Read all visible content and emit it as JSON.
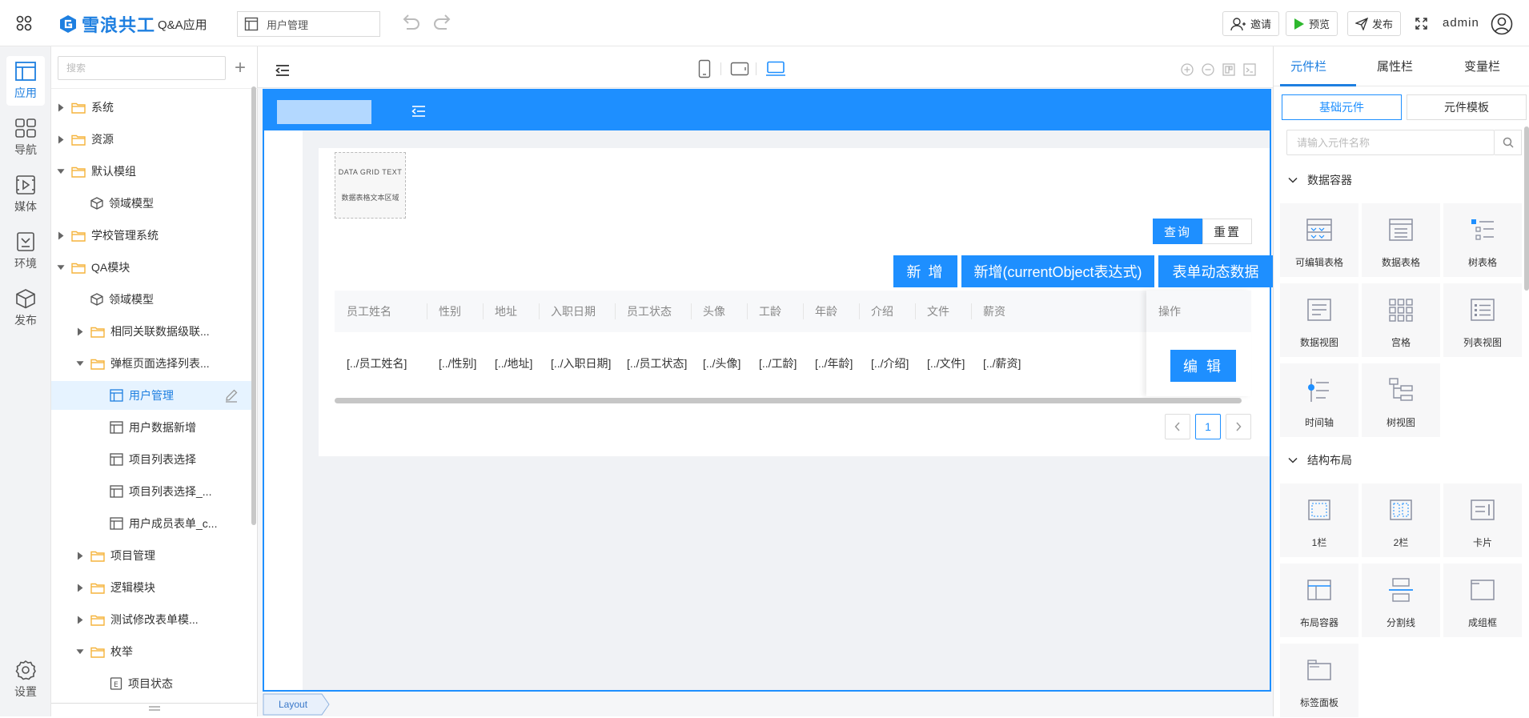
{
  "topbar": {
    "brand": "雪浪共工",
    "app_name": "Q&A应用",
    "current_page": "用户管理",
    "invite_label": "邀请",
    "preview_label": "预览",
    "publish_label": "发布",
    "user_name": "admin"
  },
  "rail": {
    "items": [
      {
        "label": "应用",
        "icon": "app-layout-icon"
      },
      {
        "label": "导航",
        "icon": "nav-grid-icon"
      },
      {
        "label": "媒体",
        "icon": "media-icon"
      },
      {
        "label": "环境",
        "icon": "env-icon"
      },
      {
        "label": "发布",
        "icon": "cube-icon"
      },
      {
        "label": "设置",
        "icon": "gear-icon"
      }
    ]
  },
  "tree": {
    "search_placeholder": "搜索",
    "items": [
      {
        "label": "系统",
        "type": "folder"
      },
      {
        "label": "资源",
        "type": "folder"
      },
      {
        "label": "默认模组",
        "type": "folder"
      },
      {
        "label": "领域模型",
        "type": "model"
      },
      {
        "label": "学校管理系统",
        "type": "folder"
      },
      {
        "label": "QA模块",
        "type": "folder"
      },
      {
        "label": "领域模型",
        "type": "model"
      },
      {
        "label": "相同关联数据级联...",
        "type": "folder"
      },
      {
        "label": "弹框页面选择列表...",
        "type": "folder"
      },
      {
        "label": "用户管理",
        "type": "page"
      },
      {
        "label": "用户数据新增",
        "type": "page"
      },
      {
        "label": "项目列表选择",
        "type": "page"
      },
      {
        "label": "项目列表选择_...",
        "type": "page"
      },
      {
        "label": "用户成员表单_c...",
        "type": "page"
      },
      {
        "label": "项目管理",
        "type": "folder"
      },
      {
        "label": "逻辑模块",
        "type": "folder"
      },
      {
        "label": "测试修改表单模...",
        "type": "folder"
      },
      {
        "label": "枚举",
        "type": "folder"
      },
      {
        "label": "项目状态",
        "type": "enum"
      }
    ]
  },
  "canvas": {
    "dg_title": "DATA GRID TEXT",
    "dg_sub": "数据表格文本区域",
    "query_label": "查询",
    "reset_label": "重置",
    "btn_new": "新 增",
    "btn_new_expr": "新增(currentObject表达式)",
    "btn_form_dynamic": "表单动态数据",
    "columns": [
      "员工姓名",
      "性别",
      "地址",
      "入职日期",
      "员工状态",
      "头像",
      "工龄",
      "年龄",
      "介绍",
      "文件",
      "薪资"
    ],
    "row": [
      "[../员工姓名]",
      "[../性别]",
      "[../地址]",
      "[../入职日期]",
      "[../员工状态]",
      "[../头像]",
      "[../工龄]",
      "[../年龄]",
      "[../介绍]",
      "[../文件]",
      "[../薪资]"
    ],
    "op_header": "操作",
    "edit_label": "编 辑",
    "page_current": "1",
    "layout_tag": "Layout"
  },
  "right_panel": {
    "tabs": [
      "元件栏",
      "属性栏",
      "变量栏"
    ],
    "segments": [
      "基础元件",
      "元件模板"
    ],
    "search_placeholder": "请输入元件名称",
    "groups": [
      {
        "title": "数据容器",
        "items": [
          "可编辑表格",
          "数据表格",
          "树表格",
          "数据视图",
          "宫格",
          "列表视图",
          "时间轴",
          "树视图"
        ]
      },
      {
        "title": "结构布局",
        "items": [
          "1栏",
          "2栏",
          "卡片",
          "布局容器",
          "分割线",
          "成组框",
          "标签面板"
        ]
      }
    ]
  },
  "colors": {
    "accent": "#1e8fff",
    "brand": "#1e7fe0",
    "folder": "#f5b43c",
    "selected_bg": "#e6f3ff"
  }
}
